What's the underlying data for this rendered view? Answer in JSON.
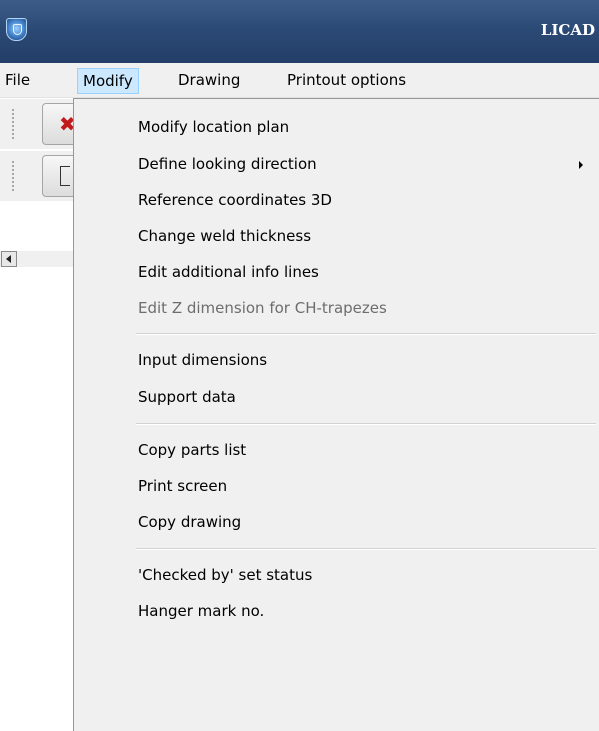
{
  "window": {
    "title": "LICAD"
  },
  "menubar": {
    "items": [
      "File",
      "Modify",
      "Drawing",
      "Printout options"
    ],
    "active": "Modify"
  },
  "modify_menu": {
    "groups": [
      [
        "Modify location plan",
        "Define looking direction",
        "Reference coordinates 3D",
        "Change weld thickness",
        "Edit additional info lines",
        "Edit Z dimension for CH-trapezes"
      ],
      [
        "Input dimensions",
        "Support data"
      ],
      [
        "Copy parts list",
        "Print screen",
        "Copy drawing"
      ],
      [
        "'Checked by' set status",
        "Hanger mark no."
      ]
    ],
    "disabled": [
      "Edit Z dimension for CH-trapezes"
    ],
    "has_submenu": [
      "Define looking direction"
    ]
  },
  "colors": {
    "titlebar": "#2c4a76",
    "menu_background": "#f0f0f0",
    "active_menu_highlight": "#cce8ff",
    "disabled_text": "#6d6d6d",
    "close_icon": "#c11a1a"
  },
  "icons": [
    "app-logo-icon",
    "red-x-icon",
    "drawing-box-icon",
    "scroll-left-arrow-icon",
    "submenu-arrow-icon"
  ]
}
